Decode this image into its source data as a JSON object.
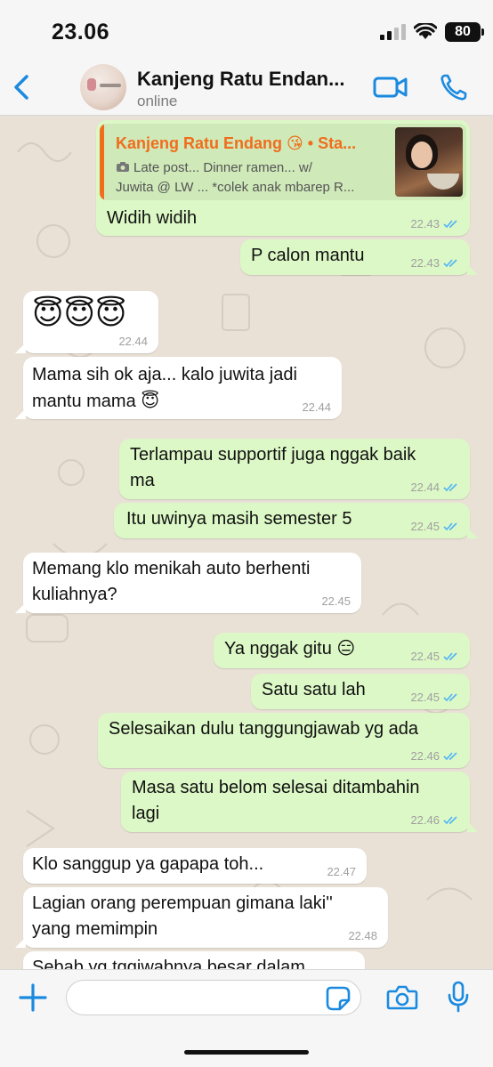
{
  "status_bar": {
    "time": "23.06",
    "battery": "80"
  },
  "header": {
    "contact_name": "Kanjeng Ratu Endan...",
    "status": "online"
  },
  "quoted": {
    "author": "Kanjeng Ratu Endang 😘 • Sta...",
    "line1": "Late post... Dinner ramen... w/",
    "line2": "Juwita @ LW ... *colek anak mbarep R...",
    "icon": "camera-icon"
  },
  "messages": [
    {
      "dir": "out",
      "text": "Widih widih",
      "time": "22.43",
      "read": true
    },
    {
      "dir": "out",
      "text": "P calon mantu",
      "time": "22.43",
      "read": true
    },
    {
      "dir": "in",
      "text": "😇😇😇",
      "time": "22.44"
    },
    {
      "dir": "in",
      "text": "Mama sih ok aja... kalo juwita jadi",
      "text2": "mantu mama 😇",
      "time": "22.44"
    },
    {
      "dir": "out",
      "text": "Terlampau supportif juga nggak baik",
      "text2": "ma",
      "time": "22.44",
      "read": true
    },
    {
      "dir": "out",
      "text": "Itu uwinya masih semester 5",
      "time": "22.45",
      "read": true
    },
    {
      "dir": "in",
      "text": "Memang klo menikah auto berhenti",
      "text2": "kuliahnya?",
      "time": "22.45"
    },
    {
      "dir": "out",
      "text": "Ya nggak gitu 😑",
      "time": "22.45",
      "read": true
    },
    {
      "dir": "out",
      "text": "Satu satu lah",
      "time": "22.45",
      "read": true
    },
    {
      "dir": "out",
      "text": "Selesaikan dulu tanggungjawab yg ada",
      "time": "22.46",
      "read": true
    },
    {
      "dir": "out",
      "text": "Masa satu belom selesai ditambahin",
      "text2": "lagi",
      "time": "22.46",
      "read": true
    },
    {
      "dir": "in",
      "text": "Klo sanggup ya gapapa toh...",
      "time": "22.47"
    },
    {
      "dir": "in",
      "text": "Lagian orang perempuan gimana laki''",
      "text2": "yang memimpin",
      "time": "22.48"
    },
    {
      "dir": "in",
      "text": "Sebab yg tggjwabnya besar dalam",
      "time": ""
    }
  ],
  "input": {
    "placeholder": ""
  },
  "colors": {
    "accent": "#1a8ae0",
    "outgoing": "#dcf8c6",
    "incoming": "#ffffff",
    "tick": "#4fb3f6",
    "quote_author": "#f06d1c"
  }
}
